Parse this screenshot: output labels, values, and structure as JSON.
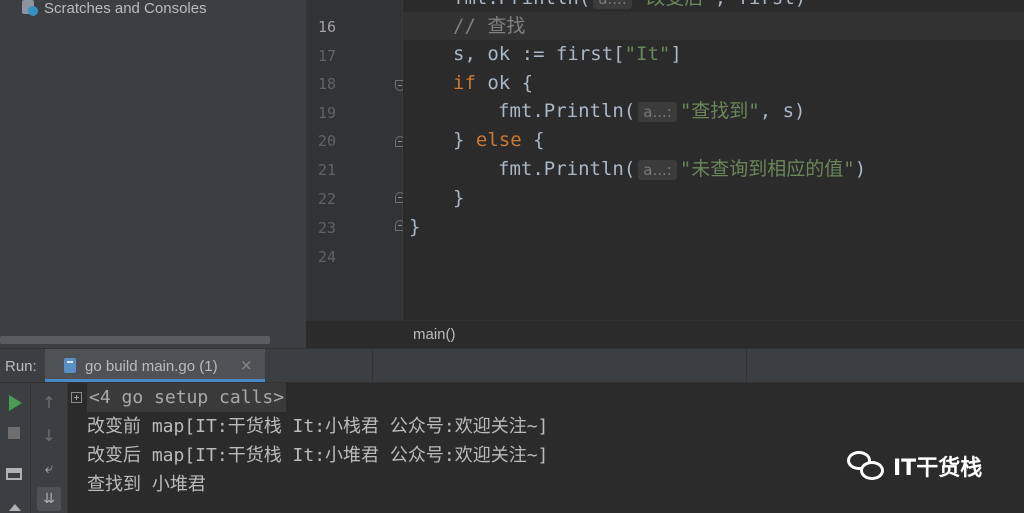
{
  "project_panel": {
    "item_label": "Scratches and Consoles",
    "item_icon": "scratches-icon"
  },
  "editor": {
    "gutter_lines": [
      {
        "num": "16",
        "current": true
      },
      {
        "num": "17",
        "current": false
      },
      {
        "num": "18",
        "current": false
      },
      {
        "num": "19",
        "current": false
      },
      {
        "num": "20",
        "current": false
      },
      {
        "num": "21",
        "current": false
      },
      {
        "num": "22",
        "current": false
      },
      {
        "num": "23",
        "current": false
      },
      {
        "num": "24",
        "current": false
      }
    ],
    "code": {
      "l15_fn": "fmt.Println(",
      "l15_hint": "a...:",
      "l15_str": "\"改变后\"",
      "l15_rest": ", first)",
      "l16_comment": "// 查找",
      "l17_a": "s, ok := first[",
      "l17_str": "\"It\"",
      "l17_b": "]",
      "l18_kw": "if",
      "l18_rest": " ok {",
      "l19_fn": "fmt.Println(",
      "l19_hint": "a...:",
      "l19_str": "\"查找到\"",
      "l19_rest": ", s)",
      "l20_a": "} ",
      "l20_kw": "else",
      "l20_b": " {",
      "l21_fn": "fmt.Println(",
      "l21_hint": "a...:",
      "l21_str": "\"未查询到相应的值\"",
      "l21_rest": ")",
      "l22": "}",
      "l23": "}"
    },
    "breadcrumb": "main()"
  },
  "run_panel": {
    "label": "Run:",
    "tab_title": "go build main.go (1)",
    "tab_close": "×",
    "console_lines": [
      "<4 go setup calls>",
      "改变前 map[IT:干货栈 It:小栈君 公众号:欢迎关注~]",
      "改变后 map[IT:干货栈 It:小堆君 公众号:欢迎关注~]",
      "查找到 小堆君"
    ],
    "toolbar": {
      "up_arrow": "↑",
      "down_arrow": "↓",
      "wrap_glyph": "⤶",
      "scroll_glyph": "⇊"
    }
  },
  "watermark": {
    "text": "IT干货栈"
  },
  "colors": {
    "keyword": "#cc7832",
    "string": "#6a8759",
    "comment": "#808080",
    "run_green": "#499c54",
    "tab_accent": "#4a88c7"
  }
}
